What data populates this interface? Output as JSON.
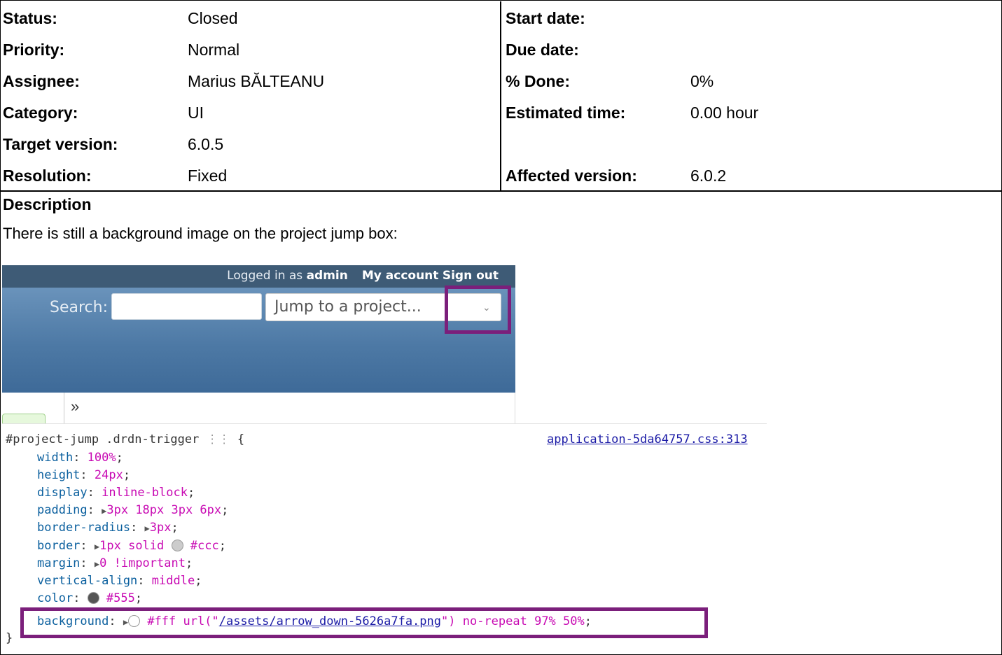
{
  "attributes": {
    "left": [
      {
        "label": "Status:",
        "value": "Closed"
      },
      {
        "label": "Priority:",
        "value": "Normal"
      },
      {
        "label": "Assignee:",
        "value": "Marius BĂLTEANU"
      },
      {
        "label": "Category:",
        "value": "UI"
      },
      {
        "label": "Target version:",
        "value": "6.0.5"
      },
      {
        "label": "Resolution:",
        "value": "Fixed"
      }
    ],
    "right": [
      {
        "label": "Start date:",
        "value": ""
      },
      {
        "label": "Due date:",
        "value": ""
      },
      {
        "label": "% Done:",
        "value": "0%"
      },
      {
        "label": "Estimated time:",
        "value": "0.00 hour"
      },
      {
        "label": "",
        "value": ""
      },
      {
        "label": "Affected version:",
        "value": "6.0.2"
      }
    ]
  },
  "description": {
    "heading": "Description",
    "text": "There is still a background image on the project jump box:"
  },
  "screenshot": {
    "logged_in_prefix": "Logged in as",
    "logged_in_user": "admin",
    "my_account": "My account",
    "sign_out": "Sign out",
    "search_label": "Search:",
    "search_value": "",
    "jump_placeholder": "Jump to a project...",
    "chevrons": "»",
    "highlight_color": "#7b1f7b"
  },
  "css_rule": {
    "selector": "#project-jump .drdn-trigger",
    "grip": "⋮⋮",
    "source": "application-5da64757.css:313",
    "declarations": [
      {
        "prop": "width",
        "value": "100%",
        "expandable": false,
        "swatch": null
      },
      {
        "prop": "height",
        "value": "24px",
        "expandable": false,
        "swatch": null
      },
      {
        "prop": "display",
        "value": "inline-block",
        "expandable": false,
        "swatch": null
      },
      {
        "prop": "padding",
        "value": "3px 18px 3px 6px",
        "expandable": true,
        "swatch": null
      },
      {
        "prop": "border-radius",
        "value": "3px",
        "expandable": true,
        "swatch": null
      },
      {
        "prop": "border",
        "value": "1px solid",
        "value_after": "#ccc",
        "expandable": true,
        "swatch": "#cccccc"
      },
      {
        "prop": "margin",
        "value": "0 !important",
        "expandable": true,
        "swatch": null
      },
      {
        "prop": "vertical-align",
        "value": "middle",
        "expandable": false,
        "swatch": null
      },
      {
        "prop": "color",
        "value": "",
        "value_after": "#555",
        "expandable": false,
        "swatch": "#555555"
      }
    ],
    "background": {
      "prop": "background",
      "color": "#fff",
      "url_prefix": "url(\"",
      "url": "/assets/arrow_down-5626a7fa.png",
      "url_suffix": "\")",
      "rest": "no-repeat 97% 50%",
      "swatch": "#ffffff"
    },
    "close_brace": "}"
  }
}
